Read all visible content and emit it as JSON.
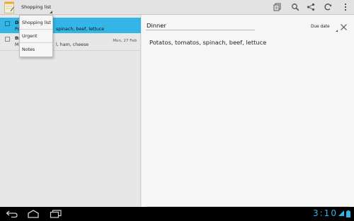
{
  "actionbar": {
    "selected_list": "Shopping list",
    "icons": [
      "app-notepad-icon",
      "add-task-icon",
      "search-icon",
      "share-icon",
      "sync-icon",
      "overflow-menu-icon"
    ]
  },
  "dropdown": {
    "items": [
      "Shopping list",
      "Urgent",
      "Notes"
    ]
  },
  "tasks": [
    {
      "title": "Dinner",
      "title_visible": "Di",
      "subtitle_visible": "Po",
      "subtitle_tail": "spinach, beef, lettuce",
      "date": "",
      "selected": true
    },
    {
      "title": "Br",
      "subtitle_visible": "M",
      "subtitle_tail": "l, ham, cheese",
      "date": "Mon, 27 Feb",
      "selected": false
    }
  ],
  "detail": {
    "title_value": "Dinner",
    "due_label": "Due date",
    "notes": "Potatos, tomatos, spinach, beef, lettuce"
  },
  "systembar": {
    "clock": "3:10"
  },
  "colors": {
    "accent": "#33b5e5",
    "actionbar": "#e3e3e3",
    "system_bar": "#000000"
  }
}
